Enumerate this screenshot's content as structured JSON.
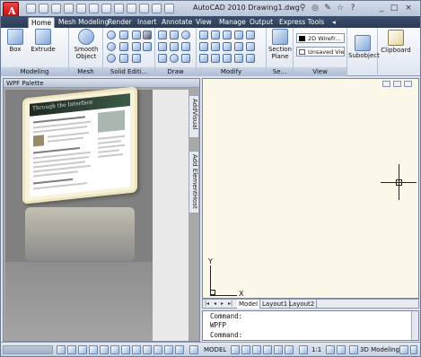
{
  "titlebar": {
    "title": "AutoCAD 2010     Drawing1.dwg"
  },
  "tabs": [
    {
      "label": "Home"
    },
    {
      "label": "Mesh Modeling"
    },
    {
      "label": "Render"
    },
    {
      "label": "Insert"
    },
    {
      "label": "Annotate"
    },
    {
      "label": "View"
    },
    {
      "label": "Manage"
    },
    {
      "label": "Output"
    },
    {
      "label": "Express Tools"
    }
  ],
  "ribbon": {
    "box_label": "Box",
    "extrude_label": "Extrude",
    "smooth_label": "Smooth Object",
    "modeling_label": "Modeling",
    "mesh_label": "Mesh",
    "solid_editing_label": "Solid Editi...",
    "draw_label": "Draw",
    "modify_label": "Modify",
    "section_group_label": "Se...",
    "section_plane_label": "Section Plane",
    "visual_style_value": "2D Wirefr...",
    "saved_view_value": "Unsaved Vie",
    "view_label": "View",
    "subobject_label": "Subobject",
    "clipboard_label": "Clipboard"
  },
  "palette": {
    "title": "WPF Palette",
    "side_tab_1": "AddVisual",
    "side_tab_2": "Add ElementHost",
    "page_header": "Through the Interface"
  },
  "drawing": {
    "y_label": "Y",
    "x_label": "X"
  },
  "layout_tabs": [
    {
      "label": "Model"
    },
    {
      "label": "Layout1"
    },
    {
      "label": "Layout2"
    }
  ],
  "command": {
    "line1": "Command:",
    "line2": "WPFP",
    "line3": "Command:"
  },
  "status": {
    "model_label": "MODEL",
    "scale_label": "1:1",
    "workspace_label": "3D Modeling"
  }
}
